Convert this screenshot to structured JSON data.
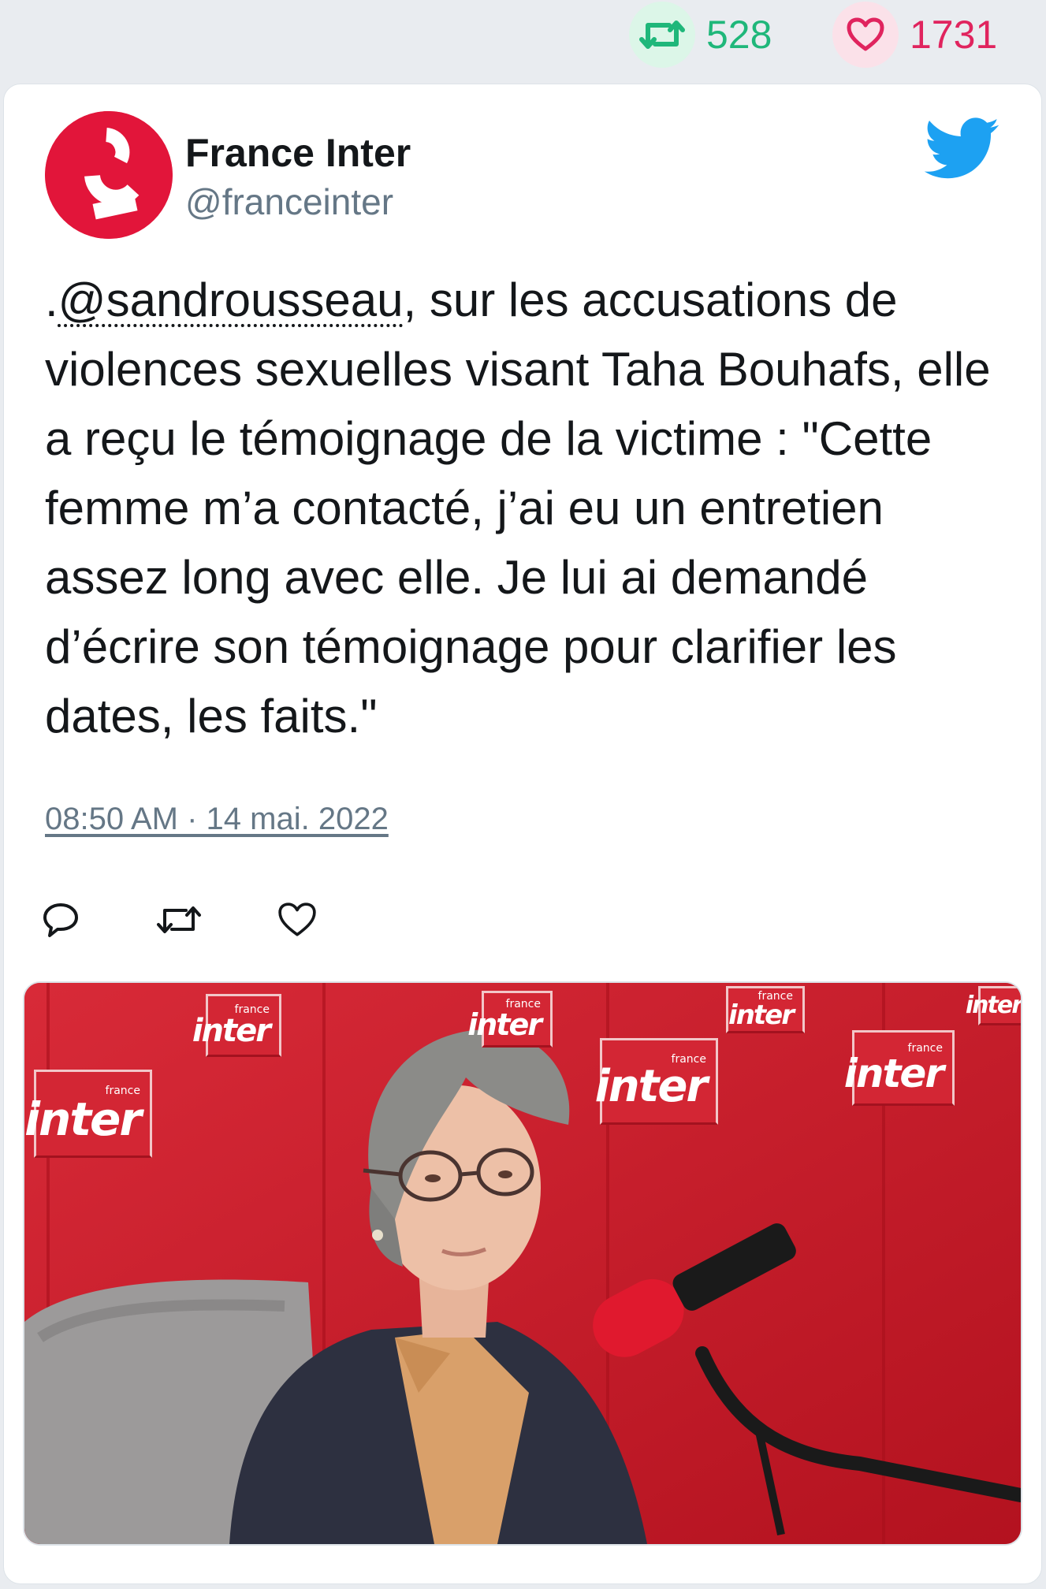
{
  "stats": {
    "retweets": "528",
    "likes": "1731"
  },
  "account": {
    "name": "France Inter",
    "handle": "@franceinter"
  },
  "tweet": {
    "prefix": ".",
    "mention": "@sandrousseau",
    "body": ", sur les accusations de violences sexuelles visant Taha Bouhafs, elle a reçu le témoignage de la victime : \"Cette femme m’a contacté, j’ai eu un entretien assez long avec elle. Je lui ai demandé d’écrire son témoignage pour clarifier les dates, les faits.\"",
    "timestamp": "08:50 AM · 14 mai. 2022"
  },
  "media": {
    "wall_logo_small": "france",
    "wall_logo_big": "inter"
  },
  "colors": {
    "retweet_green": "#1fb77a",
    "like_pink": "#e0245e",
    "brand_red": "#e2153a",
    "twitter_blue": "#1da1f2"
  },
  "icons": {
    "retweet": "retweet-icon",
    "like": "heart-icon",
    "reply": "reply-icon",
    "brand": "twitter-bird-icon"
  }
}
